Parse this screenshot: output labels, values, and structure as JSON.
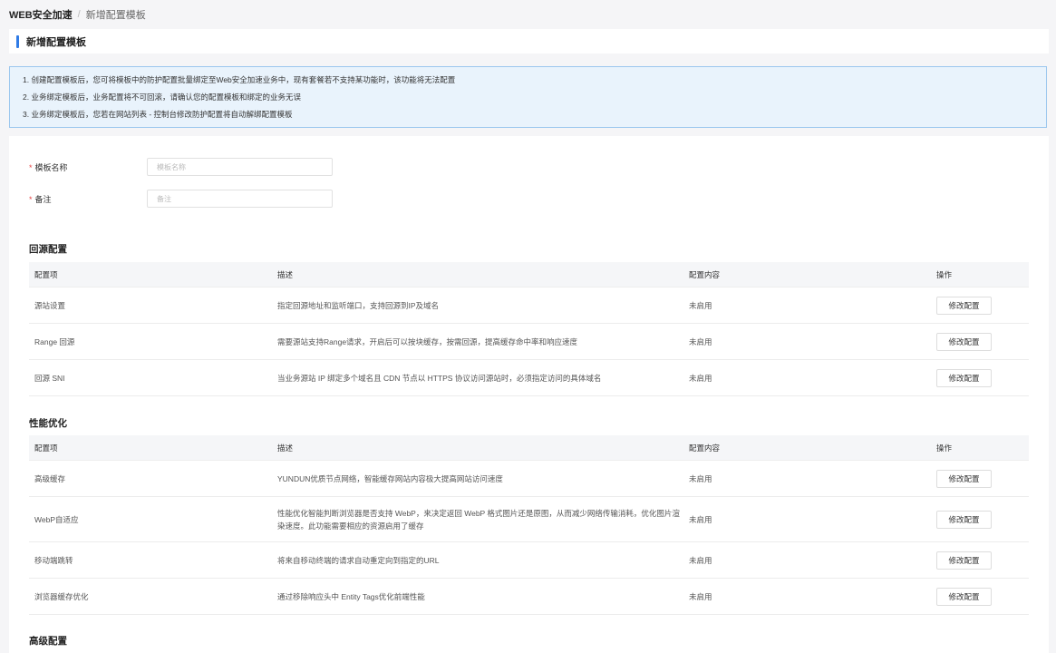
{
  "breadcrumb": {
    "root": "WEB安全加速",
    "separator": "/",
    "current": "新增配置模板"
  },
  "page_title": "新增配置模板",
  "notice": [
    "1. 创建配置模板后，您可将模板中的防护配置批量绑定至Web安全加速业务中，现有套餐若不支持某功能时，该功能将无法配置",
    "2. 业务绑定模板后，业务配置将不可回滚，请确认您的配置模板和绑定的业务无误",
    "3. 业务绑定模板后，您若在网站列表 - 控制台修改防护配置将自动解绑配置模板"
  ],
  "form": {
    "name": {
      "label": "模板名称",
      "placeholder": "模板名称",
      "required": "*"
    },
    "remark": {
      "label": "备注",
      "placeholder": "备注",
      "required": "*"
    }
  },
  "columns": {
    "item": "配置项",
    "desc": "描述",
    "content": "配置内容",
    "action": "操作"
  },
  "sections": {
    "origin": {
      "title": "回源配置",
      "rows": [
        {
          "item": "源站设置",
          "desc": "指定回源地址和监听端口，支持回源到IP及域名",
          "content": "未启用",
          "action": "修改配置"
        },
        {
          "item": "Range 回源",
          "desc": "需要源站支持Range请求，开启后可以按块缓存，按需回源，提高缓存命中率和响应速度",
          "content": "未启用",
          "action": "修改配置"
        },
        {
          "item": "回源 SNI",
          "desc": "当业务源站 IP 绑定多个域名且 CDN 节点以 HTTPS 协议访问源站时，必须指定访问的具体域名",
          "content": "未启用",
          "action": "修改配置"
        }
      ]
    },
    "perf": {
      "title": "性能优化",
      "rows": [
        {
          "item": "高级缓存",
          "desc": "YUNDUN优质节点网络，智能缓存网站内容极大提高网站访问速度",
          "content": "未启用",
          "action": "修改配置"
        },
        {
          "item": "WebP自适应",
          "desc": "性能优化智能判断浏览器是否支持 WebP，来决定返回 WebP 格式图片还是原图，从而减少网络传输消耗，优化图片渲染速度。此功能需要相应的资源启用了缓存",
          "content": "未启用",
          "action": "修改配置"
        },
        {
          "item": "移动端跳转",
          "desc": "将来自移动终端的请求自动重定向到指定的URL",
          "content": "未启用",
          "action": "修改配置"
        },
        {
          "item": "浏览器缓存优化",
          "desc": "通过移除响应头中 Entity Tags优化前端性能",
          "content": "未启用",
          "action": "修改配置"
        }
      ]
    },
    "advanced": {
      "title": "高级配置"
    }
  }
}
